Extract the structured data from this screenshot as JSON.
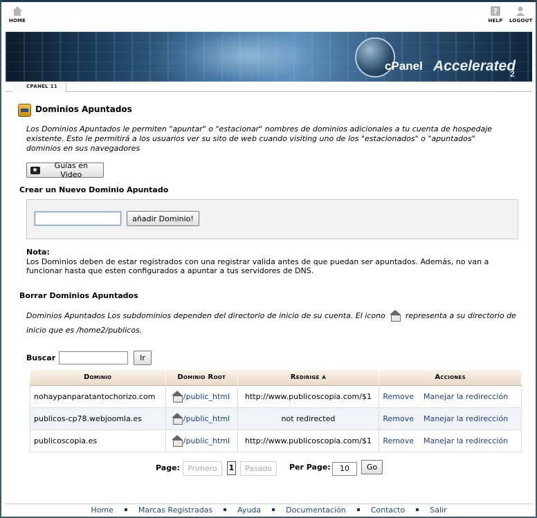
{
  "topnav": {
    "home": "HOME",
    "help": "HELP",
    "logout": "LOGOUT"
  },
  "banner": {
    "brand": "cPanel",
    "accelerated": "Accelerated",
    "version": "2"
  },
  "breadcrumb": "CPANEL 11",
  "page": {
    "title": "Dominios Apuntados",
    "intro": "Los Dominios Apuntados le permiten \"apuntar\" o \"estacionar\" nombres de dominios adicionales a tu cuenta de hospedaje existente. Esto le permitirá a los usuarios ver su sito de web cuando visiting uno de los \"estacionados\" o \"apuntados\" dominios en sus navegadores",
    "video_button": "Guías en Video"
  },
  "create": {
    "heading": "Crear un Nuevo Dominio Apuntado",
    "input_value": "",
    "add_button": "añadir Dominio!"
  },
  "note": {
    "title": "Nota:",
    "text": "Los Dominios deben de estar registrados con una registrar valida antes de que puedan ser apuntados. Además, no van a funcionar hasta que esten configurados a apuntar a tus servidores de DNS."
  },
  "delete": {
    "heading": "Borrar Dominios Apuntados",
    "desc_before": "Dominios Apuntados Los subdominios dependen del directorio de inicio de su cuenta. El icono",
    "desc_after": "representa a su directorio de inicio que es /home2/publicos."
  },
  "search": {
    "label": "Buscar",
    "value": "",
    "button": "Ir"
  },
  "table": {
    "headers": [
      "Dominio",
      "Dominio Root",
      "Redirige a",
      "Acciones"
    ],
    "rows": [
      {
        "domain": "nohaypanparatantochorizo.com",
        "root": "/public_html",
        "redirect": "http://www.publicoscopia.com/$1",
        "remove": "Remove",
        "manage": "Manejar la redirección"
      },
      {
        "domain": "publicos-cp78.webjoomla.es",
        "root": "/public_html",
        "redirect": "not redirected",
        "remove": "Remove",
        "manage": "Manejar la redirección"
      },
      {
        "domain": "publicoscopia.es",
        "root": "/public_html",
        "redirect": "http://www.publicoscopia.com/$1",
        "remove": "Remove",
        "manage": "Manejar la redirección"
      }
    ]
  },
  "pager": {
    "page_label": "Page:",
    "first": "Primero",
    "current": "1",
    "last": "Pasado",
    "per_page_label": "Per Page:",
    "per_page_value": "10",
    "go": "Go"
  },
  "footer": {
    "links": [
      "Home",
      "Marcas Registradas",
      "Ayuda",
      "Documentación",
      "Contacto",
      "Salir"
    ]
  }
}
